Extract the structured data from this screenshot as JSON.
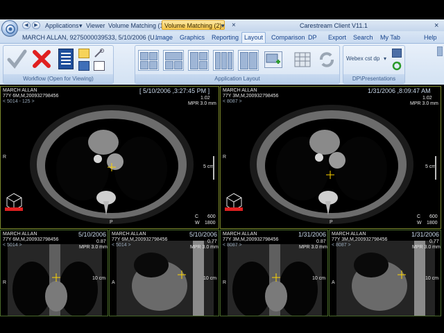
{
  "window": {
    "title": "Carestream Client V11.1",
    "close_glyph": "×"
  },
  "toolbar": {
    "applications": "Applications",
    "viewer": "Viewer",
    "volume_matching_1": "Volume Matching (1)",
    "volume_matching_2": "Volume Matching (2)",
    "close_tab": "×",
    "dropdown_glyph": "▾"
  },
  "patient_bar": {
    "text": "MARCH  ALLAN,  9275000039533,  5/10/2006  (U.."
  },
  "ribbon_tabs": [
    "Image",
    "Graphics",
    "Reporting",
    "Layout",
    "Comparison",
    "DP",
    "Export",
    "Search",
    "My Tab",
    "Help"
  ],
  "ribbon_tab_active": "Layout",
  "ribbon_groups": {
    "workflow": "Workflow (Open for Viewing)",
    "application_layout": "Application Layout",
    "dp_presentations": "DP\\Presentations"
  },
  "dp_combo": "Webex cst dp",
  "panes": [
    {
      "name": "MARCH ALLAN",
      "info": "77Y 6M,M,200932798456",
      "series": "< 5014 - 125 >",
      "date": "[ 5/10/2006 ,3:27:45 PM ]",
      "zoom": "1.02",
      "mpr": "MPR 3.0 mm",
      "scale": "5 cm",
      "c": "C",
      "w": "W",
      "c_val": "600",
      "w_val": "1800",
      "orient_r": "R",
      "orient_p": "P"
    },
    {
      "name": "MARCH ALLAN",
      "info": "77Y 3M,M,200932798456",
      "series": "< 8087 >",
      "date": "1/31/2006 ,8:09:47 AM",
      "zoom": "1.02",
      "mpr": "MPR 3.0 mm",
      "scale": "5 cm",
      "c": "C",
      "w": "W",
      "c_val": "600",
      "w_val": "1800",
      "orient_r": "R",
      "orient_p": "P"
    }
  ],
  "small_panes": [
    {
      "name": "MARCH ALLAN",
      "info": "77Y 6M,M,200932798456",
      "series": "< 5014 >",
      "date": "5/10/2006",
      "zoom": "0.87",
      "mpr": "MPR 3.0 mm",
      "scale": "10 cm",
      "orient": "R"
    },
    {
      "name": "MARCH ALLAN",
      "info": "77Y 6M,M,200932798456",
      "series": "< 5014 >",
      "date": "5/10/2006",
      "zoom": "0.77",
      "mpr": "MPR 3.0 mm",
      "scale": "10 cm",
      "orient": "A"
    },
    {
      "name": "MARCH ALLAN",
      "info": "77Y 3M,M,200932798456",
      "series": "< 8087 >",
      "date": "1/31/2006",
      "zoom": "0.87",
      "mpr": "MPR 3.0 mm",
      "scale": "10 cm",
      "orient": "R"
    },
    {
      "name": "MARCH ALLAN",
      "info": "77Y 3M,M,200932798456",
      "series": "< 8087 >",
      "date": "1/31/2006",
      "zoom": "0.77",
      "mpr": "MPR 3.0 mm",
      "scale": "10 cm",
      "orient": "A"
    }
  ],
  "icons": [
    "app-orb-icon",
    "back-arrow-icon",
    "forward-arrow-icon",
    "checkmark-icon",
    "red-x-icon",
    "list-icon",
    "notes-icon",
    "tools-icon",
    "layout-grid-icon",
    "save-icon",
    "refresh-icon",
    "orientation-cube-icon"
  ],
  "colors": {
    "accent_tab": "#f6c74b",
    "ribbon": "#d3e2f3",
    "pane_border": "#7c8a2c",
    "cube": "#e02020"
  }
}
